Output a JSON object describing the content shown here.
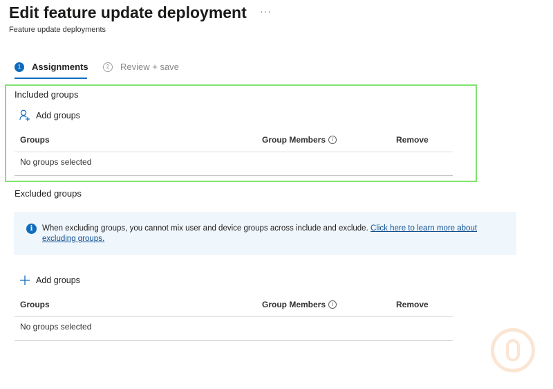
{
  "page": {
    "title": "Edit feature update deployment",
    "more_label": "···",
    "subtitle": "Feature update deployments"
  },
  "steps": [
    {
      "number": "1",
      "label": "Assignments",
      "state": "active"
    },
    {
      "number": "2",
      "label": "Review + save",
      "state": "inactive"
    }
  ],
  "included": {
    "title": "Included groups",
    "add_label": "Add groups",
    "add_icon": "add-user-icon",
    "columns": [
      "Groups",
      "Group Members",
      "Remove"
    ],
    "empty_text": "No groups selected"
  },
  "excluded": {
    "title": "Excluded groups",
    "notice_text": "When excluding groups, you cannot mix user and device groups across include and exclude. ",
    "notice_link": "Click here to learn more about excluding groups.",
    "add_label": "Add groups",
    "add_icon": "plus-icon",
    "columns": [
      "Groups",
      "Group Members",
      "Remove"
    ],
    "empty_text": "No groups selected"
  },
  "colors": {
    "accent": "#0f6cbd",
    "highlight": "#7fe36f",
    "notice_bg": "#eff6fc"
  }
}
